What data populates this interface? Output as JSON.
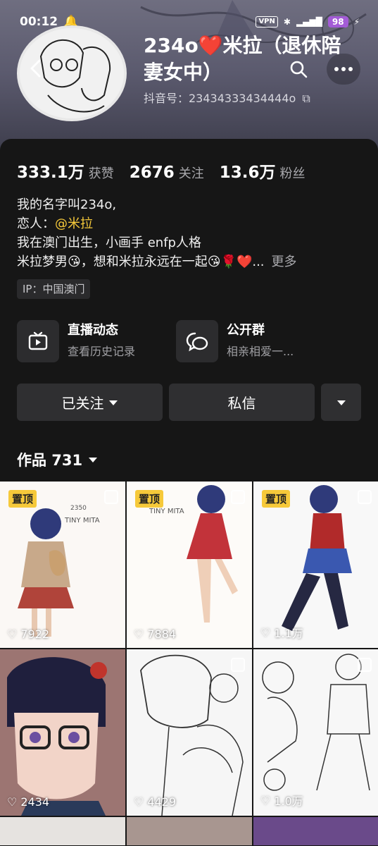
{
  "status": {
    "time": "00:12",
    "vpn": "VPN",
    "battery": "98"
  },
  "profile": {
    "name": "234o❤️米拉（退休陪妻女中）",
    "douyin_id": "抖音号：23434333434444o"
  },
  "stats": [
    {
      "num": "333.1万",
      "label": "获赞"
    },
    {
      "num": "2676",
      "label": "关注"
    },
    {
      "num": "13.6万",
      "label": "粉丝"
    }
  ],
  "bio": {
    "line1": "我的名字叫234o,",
    "line2_prefix": "恋人：",
    "line2_mention": "@米拉",
    "line3": "我在澳门出生，小画手 enfp人格",
    "line4": "米拉梦男😘，想和米拉永远在一起😘🌹❤️...",
    "more": "更多"
  },
  "ip": "IP：中国澳门",
  "features": [
    {
      "title": "直播动态",
      "sub": "查看历史记录"
    },
    {
      "title": "公开群",
      "sub": "相亲相爱一..."
    }
  ],
  "buttons": {
    "follow": "已关注",
    "message": "私信"
  },
  "works": {
    "label": "作品 731"
  },
  "pin_label": "置顶",
  "posts": [
    {
      "likes": "7922",
      "pinned": true
    },
    {
      "likes": "7884",
      "pinned": true
    },
    {
      "likes": "1.1万",
      "pinned": true
    },
    {
      "likes": "2434",
      "pinned": false
    },
    {
      "likes": "4429",
      "pinned": false
    },
    {
      "likes": "1.0万",
      "pinned": false
    }
  ],
  "colors": {
    "accent": "#f6c93a",
    "battery": "#a35bd6"
  }
}
